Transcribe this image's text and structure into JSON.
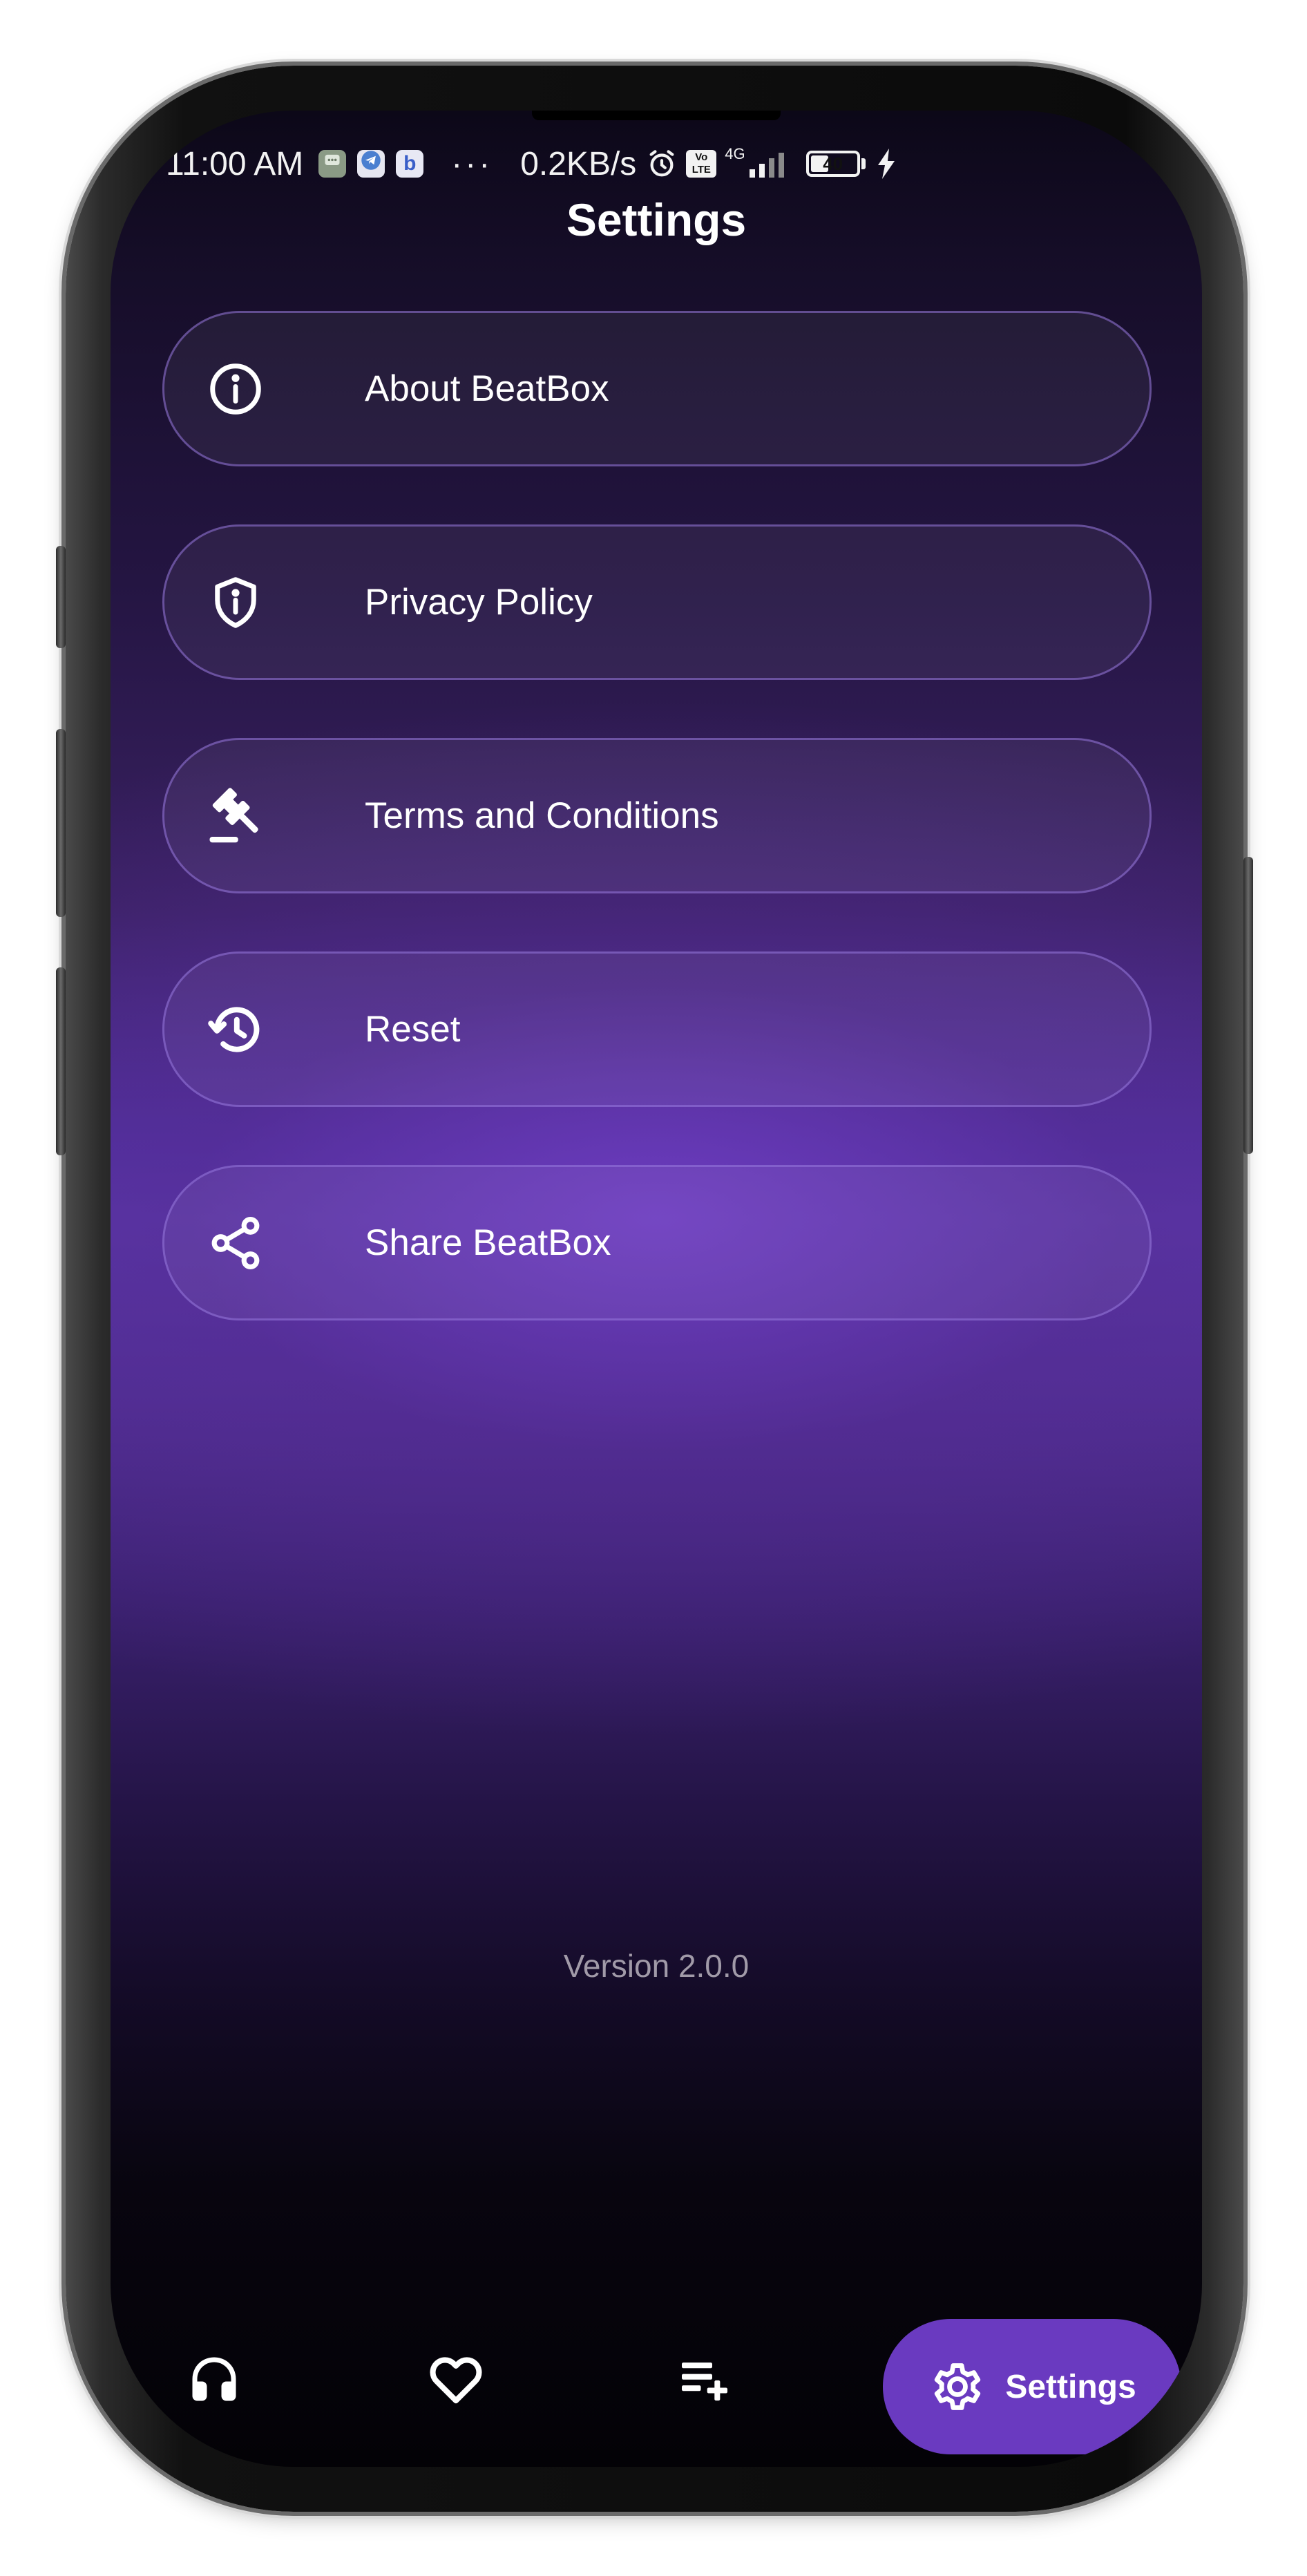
{
  "status_bar": {
    "time": "11:00 AM",
    "more": "···",
    "net_speed": "0.2KB/s",
    "net_type": "4G",
    "volte": "Vo LTE",
    "battery_level": "40",
    "battery_fraction": 0.4,
    "app_badges": [
      "messages-app-icon",
      "telegram-app-icon",
      "bing-app-icon"
    ],
    "bing_letter": "b"
  },
  "header": {
    "title": "Settings"
  },
  "settings": {
    "items": [
      {
        "label": "About BeatBox",
        "icon": "info-icon"
      },
      {
        "label": "Privacy Policy",
        "icon": "shield-info-icon"
      },
      {
        "label": "Terms and Conditions",
        "icon": "gavel-icon"
      },
      {
        "label": "Reset",
        "icon": "history-icon"
      },
      {
        "label": "Share BeatBox",
        "icon": "share-icon"
      }
    ]
  },
  "footer": {
    "version": "Version 2.0.0"
  },
  "bottom_nav": {
    "items": [
      {
        "icon": "headphones-icon"
      },
      {
        "icon": "heart-icon"
      },
      {
        "icon": "playlist-add-icon"
      },
      {
        "icon": "gear-icon",
        "label": "Settings",
        "active": true
      }
    ]
  },
  "colors": {
    "accent": "#6a3ac0",
    "item_border": "#9676dc",
    "text": "#ffffff",
    "version_text": "#a19aa8"
  }
}
